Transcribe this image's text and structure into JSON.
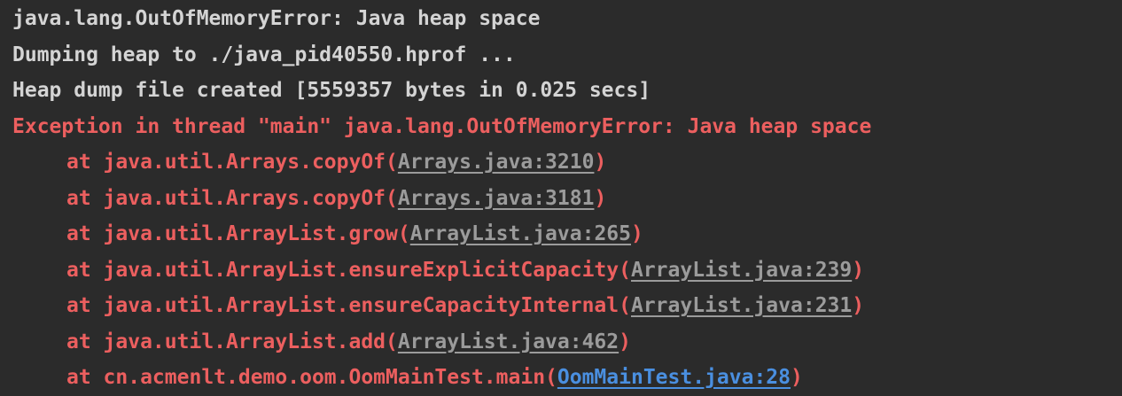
{
  "colors": {
    "background": "#2b2b2b",
    "plain_text": "#d4d4d4",
    "error_text": "#ec5f5f",
    "library_link": "#9b9b9b",
    "user_code_link": "#4a8fe0"
  },
  "console": {
    "lines": [
      "java.lang.OutOfMemoryError: Java heap space",
      "Dumping heap to ./java_pid40550.hprof ...",
      "Heap dump file created [5559357 bytes in 0.025 secs]"
    ],
    "exception": "Exception in thread \"main\" java.lang.OutOfMemoryError: Java heap space",
    "frames": [
      {
        "method": "at java.util.Arrays.copyOf(",
        "source": "Arrays.java:3210",
        "close": ")"
      },
      {
        "method": "at java.util.Arrays.copyOf(",
        "source": "Arrays.java:3181",
        "close": ")"
      },
      {
        "method": "at java.util.ArrayList.grow(",
        "source": "ArrayList.java:265",
        "close": ")"
      },
      {
        "method": "at java.util.ArrayList.ensureExplicitCapacity(",
        "source": "ArrayList.java:239",
        "close": ")"
      },
      {
        "method": "at java.util.ArrayList.ensureCapacityInternal(",
        "source": "ArrayList.java:231",
        "close": ")"
      },
      {
        "method": "at java.util.ArrayList.add(",
        "source": "ArrayList.java:462",
        "close": ")"
      },
      {
        "method": "at cn.acmenlt.demo.oom.OomMainTest.main(",
        "source": "OomMainTest.java:28",
        "close": ")"
      }
    ]
  }
}
